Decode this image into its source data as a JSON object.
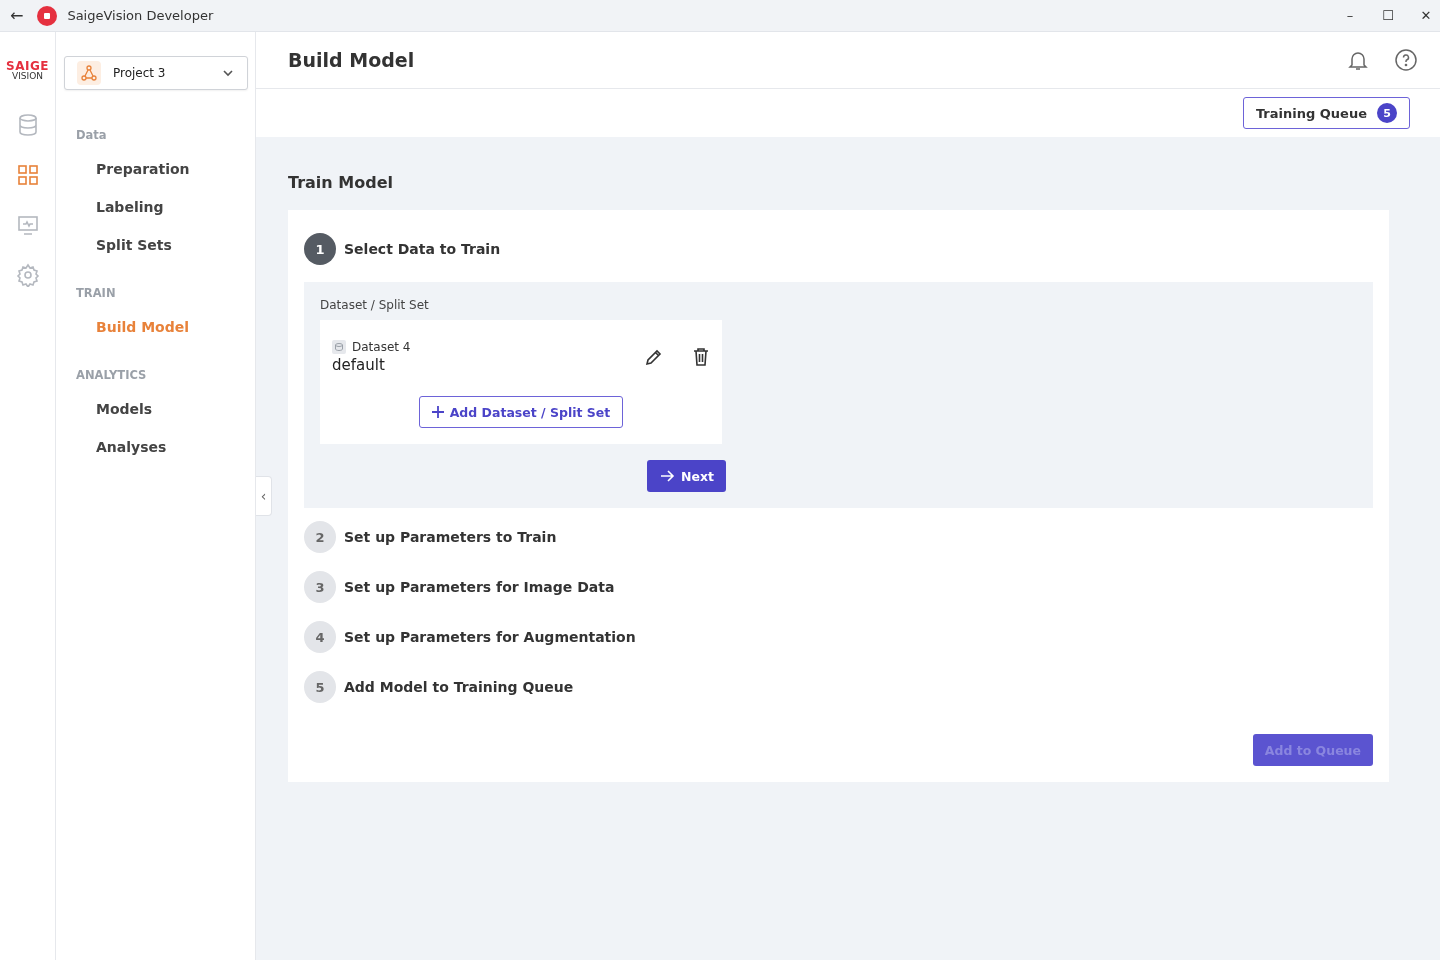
{
  "window": {
    "title": "SaigeVision Developer",
    "back": "←",
    "minimize": "–",
    "maximize": "☐",
    "close": "✕"
  },
  "logo": {
    "line_1": "SAIGE",
    "line_2": "VISION"
  },
  "rail": [
    {
      "kind": "database",
      "selected": false
    },
    {
      "kind": "grid",
      "selected": true
    },
    {
      "kind": "monitor",
      "selected": false
    },
    {
      "kind": "gear",
      "selected": false
    }
  ],
  "project": {
    "name": "Project 3"
  },
  "nav": [
    {
      "heading": "Data",
      "items": [
        {
          "label": "Preparation",
          "selected": false
        },
        {
          "label": "Labeling",
          "selected": false
        },
        {
          "label": "Split Sets",
          "selected": false
        }
      ]
    },
    {
      "heading": "TRAIN",
      "items": [
        {
          "label": "Build Model",
          "selected": true
        }
      ]
    },
    {
      "heading": "ANALYTICS",
      "items": [
        {
          "label": "Models",
          "selected": false
        },
        {
          "label": "Analyses",
          "selected": false
        }
      ]
    }
  ],
  "collapse": "‹",
  "header": {
    "title": "Build Model"
  },
  "training_queue": {
    "label": "Training Queue",
    "count": "5"
  },
  "section_title": "Train Model",
  "steps": [
    {
      "number": "1",
      "label": "Select Data to Train",
      "active": true
    },
    {
      "number": "2",
      "label": "Set up Parameters to Train",
      "active": false
    },
    {
      "number": "3",
      "label": "Set up Parameters for Image Data",
      "active": false
    },
    {
      "number": "4",
      "label": "Set up Parameters for Augmentation",
      "active": false
    },
    {
      "number": "5",
      "label": "Add Model to Training Queue",
      "active": false
    }
  ],
  "dataset_panel": {
    "label": "Dataset / Split Set",
    "dataset": "Dataset 4",
    "split": "default",
    "add": "Add Dataset / Split Set",
    "next": "Next"
  },
  "add_to_queue": {
    "label": "Add to Queue",
    "disabled": true
  }
}
